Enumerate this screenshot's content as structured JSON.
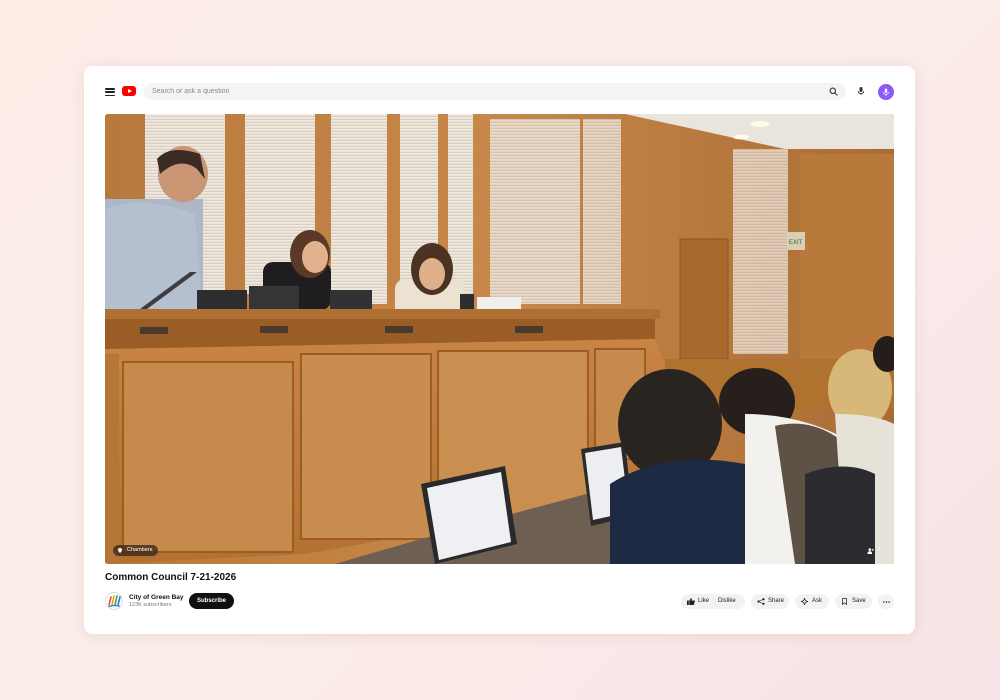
{
  "header": {
    "search_placeholder": "Search or ask a question",
    "icons": [
      "menu-icon",
      "youtube-logo-icon",
      "search-icon",
      "mic-icon",
      "assistant-mic-icon"
    ]
  },
  "video": {
    "location_chip": "Chambers",
    "viewer_count": "7",
    "progress_fraction": 0
  },
  "title": "Common Council 7-21-2026",
  "channel": {
    "name": "City of Green Bay",
    "subscribers": "123K subscribers",
    "subscribe_label": "Subscribe"
  },
  "actions": {
    "like_label": "Like",
    "dislike_label": "Dislike",
    "share_label": "Share",
    "ask_label": "Ask",
    "save_label": "Save",
    "more_icon": "more-horizontal-icon"
  },
  "colors": {
    "brand_red": "#ff0000",
    "assistant_purple": "#8b5cf6",
    "subscribe_bg": "#111111"
  }
}
